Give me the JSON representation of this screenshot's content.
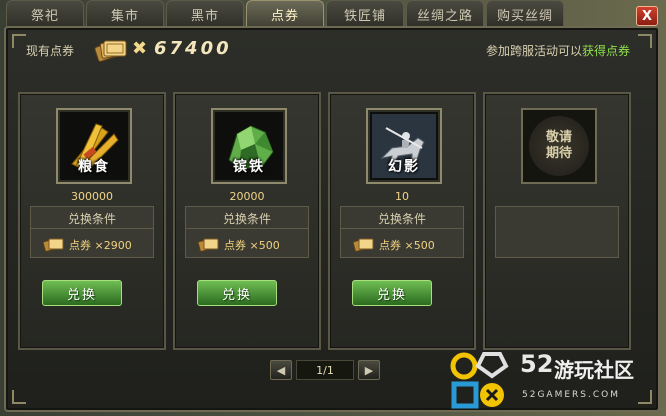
{
  "tabs": [
    {
      "label": "祭祀"
    },
    {
      "label": "集市"
    },
    {
      "label": "黑市"
    },
    {
      "label": "点券"
    },
    {
      "label": "铁匠铺"
    },
    {
      "label": "丝绸之路"
    },
    {
      "label": "购买丝绸"
    }
  ],
  "active_tab": 3,
  "close_label": "X",
  "balance": {
    "label": "现有点券",
    "times": "✖",
    "value": "67400"
  },
  "event": {
    "prefix": "参加跨服活动可以",
    "link": "获得点券"
  },
  "cards": [
    {
      "name": "粮食",
      "icon": "grain-bundle-icon",
      "quantity": "300000",
      "cond_title": "兑换条件",
      "cond_text": "点券 ×2900",
      "button": "兑换"
    },
    {
      "name": "镔铁",
      "icon": "green-iron-ore-icon",
      "quantity": "20000",
      "cond_title": "兑换条件",
      "cond_text": "点券 ×500",
      "button": "兑换"
    },
    {
      "name": "幻影",
      "icon": "phantom-horse-rider-icon",
      "quantity": "10",
      "cond_title": "兑换条件",
      "cond_text": "点券 ×500",
      "button": "兑换"
    },
    {
      "name": "敬请期待",
      "name_line1": "敬请",
      "name_line2": "期待"
    }
  ],
  "pager": {
    "label": "1/1",
    "prev": "◀",
    "next": "▶"
  },
  "watermark": {
    "num": "52",
    "cn": "游玩社区",
    "url": "52GAMERS.COM"
  },
  "colors": {
    "accent_gold": "#f3d78b",
    "link_green": "#8fe04b",
    "button_green": "#4f9a3a",
    "close_red": "#c0392b"
  }
}
